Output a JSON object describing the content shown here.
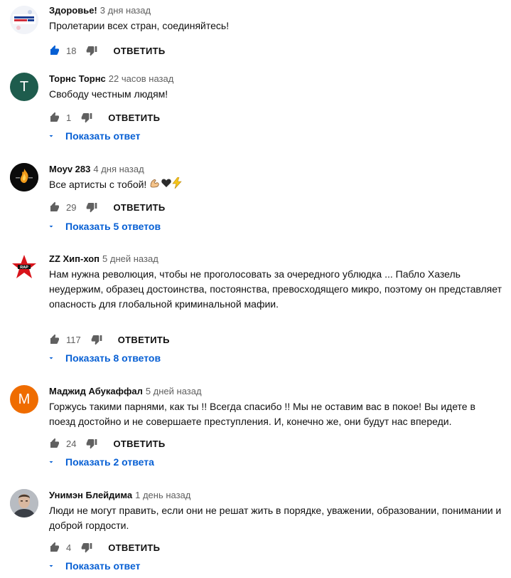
{
  "comments": [
    {
      "author": "Здоровье!",
      "time": "3 дня назад",
      "text": "Пролетарии всех стран, соединяйтесь!",
      "likes": "18",
      "reply_label": "ОТВЕТИТЬ",
      "show_replies": "",
      "avatar_letter": "",
      "avatar_color": "#e9eef7"
    },
    {
      "author": "Торнс Торнс",
      "time": "22 часов назад",
      "text": "Свободу честным  людям!",
      "likes": "1",
      "reply_label": "ОТВЕТИТЬ",
      "show_replies": "Показать ответ",
      "avatar_letter": "T",
      "avatar_color": "#1e5c4d"
    },
    {
      "author": "Моуv 283",
      "time": "4 дня назад",
      "text": "Все артисты с тобой!",
      "likes": "29",
      "reply_label": "ОТВЕТИТЬ",
      "show_replies": "Показать 5 ответов",
      "avatar_letter": "",
      "avatar_color": "#111111"
    },
    {
      "author": "ZZ Хип-хоп",
      "time": "5 дней назад",
      "text": "Нам нужна революция, чтобы не проголосовать за очередного ублюдка ... Пабло Хазель неудержим, образец достоинства, постоянства, превосходящего микро, поэтому он представляет опасность для глобальной криминальной мафии.",
      "likes": "117",
      "reply_label": "ОТВЕТИТЬ",
      "show_replies": "Показать 8 ответов",
      "avatar_letter": "",
      "avatar_color": "#ffffff"
    },
    {
      "author": "Маджид Абукаффал",
      "time": "5 дней назад",
      "text": "Горжусь такими парнями, как ты !! Всегда спасибо !! Мы не оставим вас в покое! Вы идете в поезд достойно и не совершаете преступления. И, конечно же, они будут нас впереди.",
      "likes": "24",
      "reply_label": "ОТВЕТИТЬ",
      "show_replies": "Показать 2 ответа",
      "avatar_letter": "M",
      "avatar_color": "#ef6c00"
    },
    {
      "author": "Унимэн Блейдима",
      "time": "1 день назад",
      "text": "Люди не могут править, если они не решат жить в порядке, уважении, образовании, понимании и доброй гордости.",
      "likes": "4",
      "reply_label": "ОТВЕТИТЬ",
      "show_replies": "Показать ответ",
      "avatar_letter": "",
      "avatar_color": "#9aa0a6"
    }
  ],
  "icons": {
    "like": "thumb-up-icon",
    "dislike": "thumb-down-icon",
    "chevron": "chevron-down-icon"
  },
  "colors": {
    "link": "#065fd4",
    "liked": "#065fd4",
    "muted": "#606060"
  }
}
